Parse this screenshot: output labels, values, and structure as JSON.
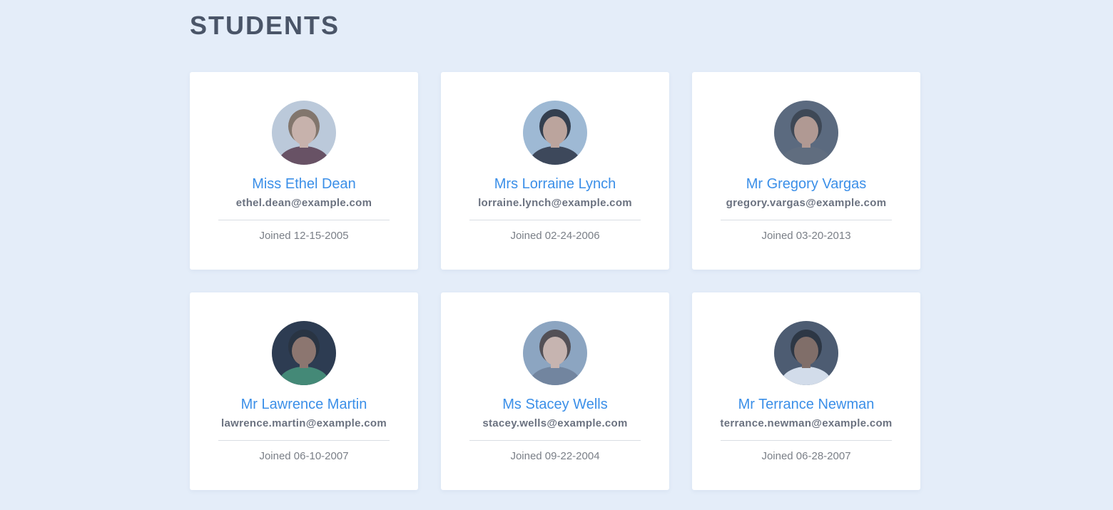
{
  "page": {
    "title": "STUDENTS"
  },
  "students": [
    {
      "name": "Miss Ethel Dean",
      "email": "ethel.dean@example.com",
      "joined": "Joined 12-15-2005",
      "avatar": {
        "bg": "#c9d6e2",
        "skin": "#e6b79c",
        "hair": "#8a6a4a",
        "shirt": "#6b3a4a"
      }
    },
    {
      "name": "Mrs Lorraine Lynch",
      "email": "lorraine.lynch@example.com",
      "joined": "Joined 02-24-2006",
      "avatar": {
        "bg": "#9fc2e0",
        "skin": "#d7a487",
        "hair": "#1e2530",
        "shirt": "#2a3040"
      }
    },
    {
      "name": "Mr Gregory Vargas",
      "email": "gregory.vargas@example.com",
      "joined": "Joined 03-20-2013",
      "avatar": {
        "bg": "#4f5d70",
        "skin": "#c8957a",
        "hair": "#2b3038",
        "shirt": "#55606e"
      }
    },
    {
      "name": "Mr Lawrence Martin",
      "email": "lawrence.martin@example.com",
      "joined": "Joined 06-10-2007",
      "avatar": {
        "bg": "#122236",
        "skin": "#9a6a4e",
        "hair": "#10161f",
        "shirt": "#1f8a5a"
      }
    },
    {
      "name": "Ms Stacey Wells",
      "email": "stacey.wells@example.com",
      "joined": "Joined 09-22-2004",
      "avatar": {
        "bg": "#8aa8c8",
        "skin": "#e3b9a2",
        "hair": "#4a3a32",
        "shirt": "#6a7f9c"
      }
    },
    {
      "name": "Mr Terrance Newman",
      "email": "terrance.newman@example.com",
      "joined": "Joined 06-28-2007",
      "avatar": {
        "bg": "#3b4b5f",
        "skin": "#8a5f46",
        "hair": "#151a22",
        "shirt": "#e8eef5"
      }
    }
  ]
}
